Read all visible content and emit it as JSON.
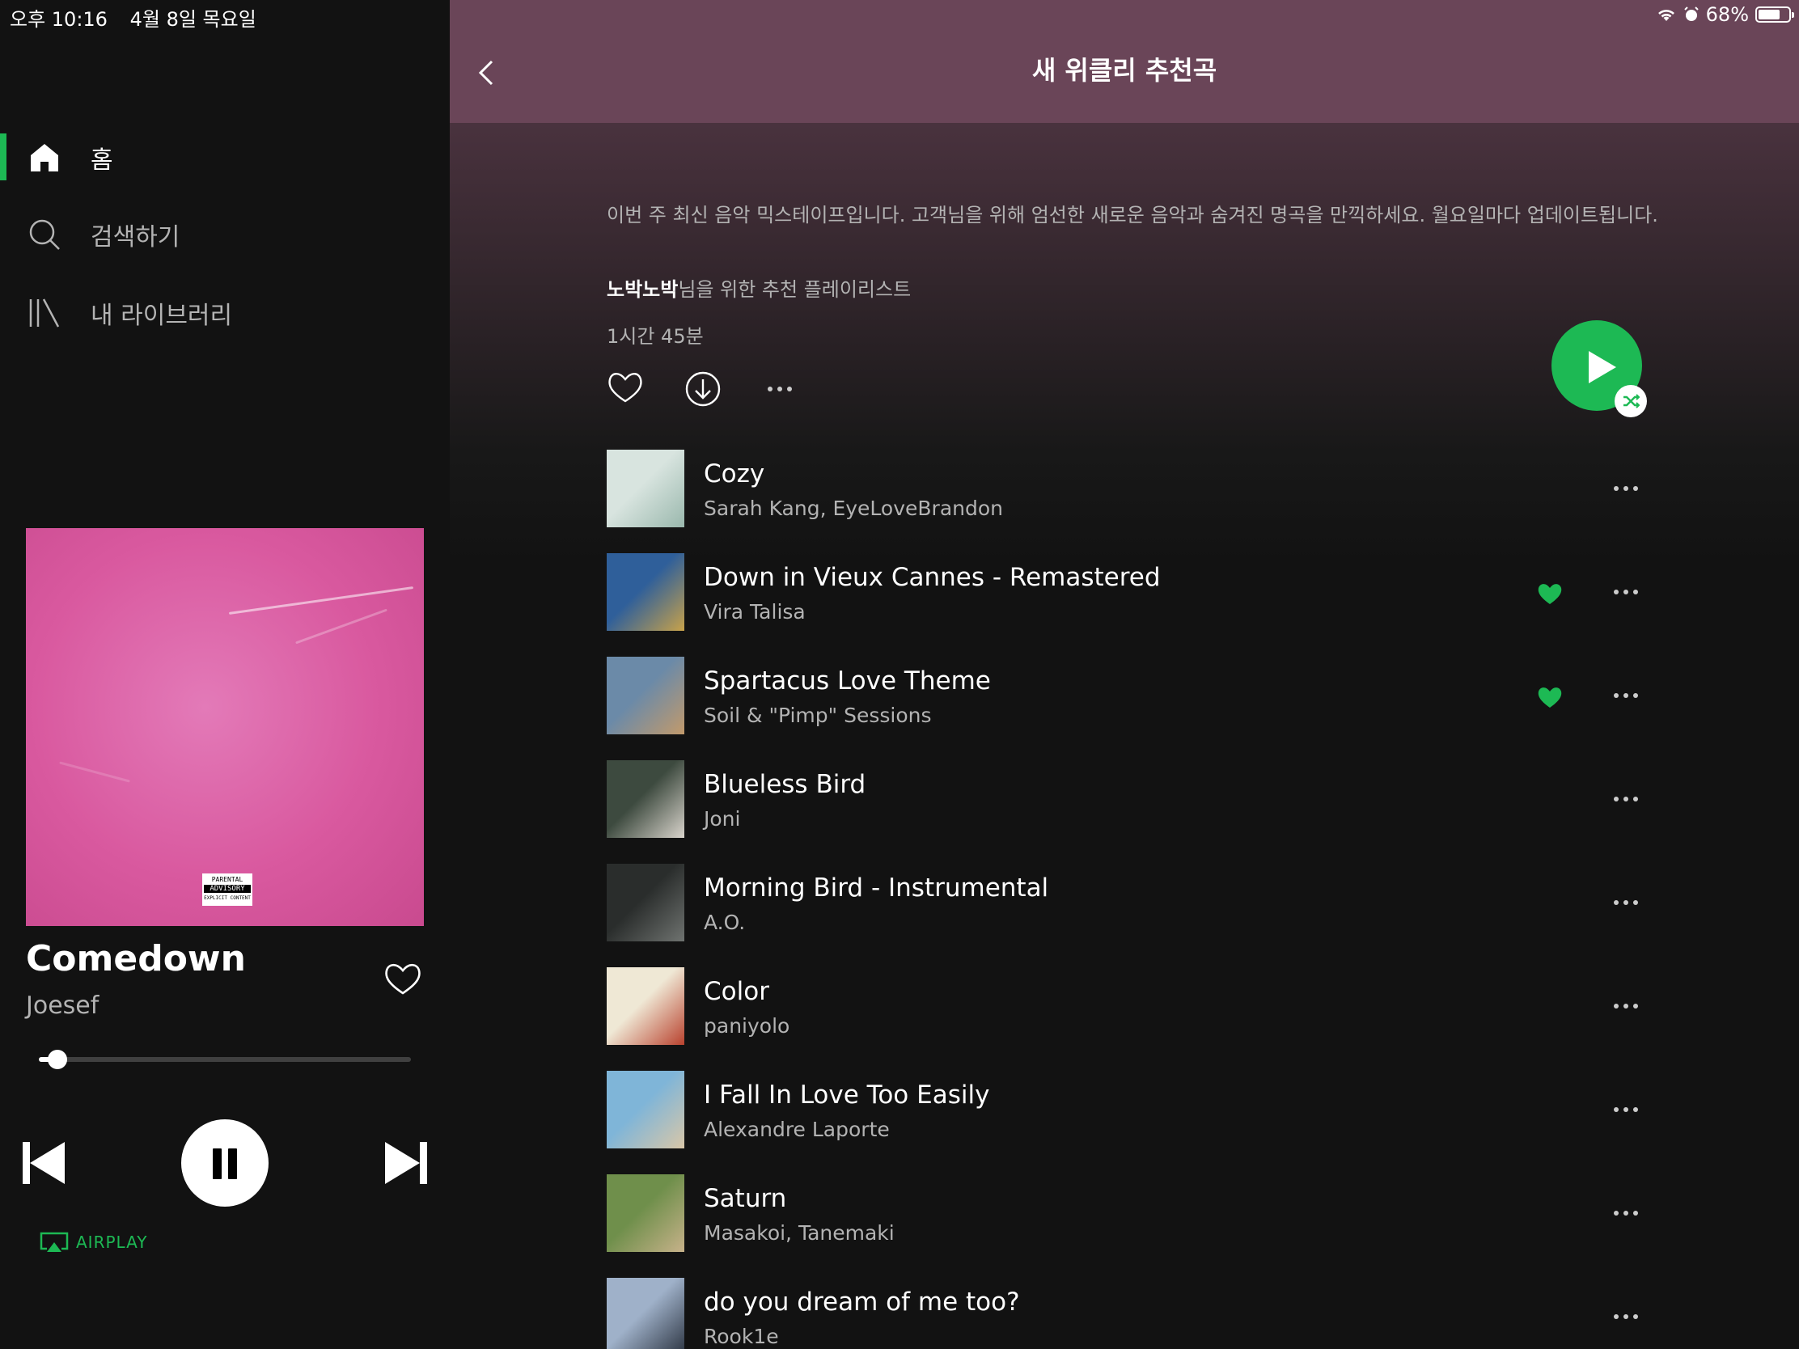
{
  "status_bar": {
    "time": "오후 10:16",
    "date": "4월 8일 목요일",
    "battery": "68%",
    "battery_level": 0.68
  },
  "sidebar": {
    "items": [
      {
        "label": "홈",
        "icon": "home-icon",
        "active": true
      },
      {
        "label": "검색하기",
        "icon": "search-icon",
        "active": false
      },
      {
        "label": "내 라이브러리",
        "icon": "library-icon",
        "active": false
      }
    ]
  },
  "now_playing": {
    "title": "Comedown",
    "artist": "Joesef",
    "progress": 0.05,
    "advisory_line1": "PARENTAL",
    "advisory_line2": "ADVISORY",
    "advisory_line3": "EXPLICIT CONTENT",
    "airplay_label": "AIRPLAY"
  },
  "playlist": {
    "title": "새 위클리 추천곡",
    "description": "이번 주 최신 음악 믹스테이프입니다. 고객님을 위해 엄선한 새로운 음악과 숨겨진 명곡을 만끽하세요. 월요일마다 업데이트됩니다.",
    "made_for_user": "노박노박",
    "made_for_suffix": "님을 위한 추천 플레이리스트",
    "duration": "1시간 45분"
  },
  "tracks": [
    {
      "title": "Cozy",
      "artist": "Sarah Kang, EyeLoveBrandon",
      "liked": false,
      "art": [
        "#d8e4df",
        "#9ab8ad"
      ]
    },
    {
      "title": "Down in Vieux Cannes - Remastered",
      "artist": "Vira Talisa",
      "liked": true,
      "art": [
        "#2f5f9a",
        "#c8a24a"
      ]
    },
    {
      "title": "Spartacus Love Theme",
      "artist": "Soil & \"Pimp\" Sessions",
      "liked": true,
      "art": [
        "#6b8aa8",
        "#c29a6b"
      ]
    },
    {
      "title": "Blueless Bird",
      "artist": "Joni",
      "liked": false,
      "art": [
        "#3d4a3f",
        "#d9d4cc"
      ]
    },
    {
      "title": "Morning Bird - Instrumental",
      "artist": "A.O.",
      "liked": false,
      "art": [
        "#2a2d2c",
        "#6f7370"
      ]
    },
    {
      "title": "Color",
      "artist": "paniyolo",
      "liked": false,
      "art": [
        "#efe8d5",
        "#b9422e"
      ]
    },
    {
      "title": "I Fall In Love Too Easily",
      "artist": "Alexandre Laporte",
      "liked": false,
      "art": [
        "#7fb5d8",
        "#d9c7a8"
      ]
    },
    {
      "title": "Saturn",
      "artist": "Masakoi, Tanemaki",
      "liked": false,
      "art": [
        "#6f8f4b",
        "#c7b28a"
      ]
    },
    {
      "title": "do you dream of me too?",
      "artist": "Rook1e",
      "liked": false,
      "art": [
        "#9fb1c9",
        "#2b3340"
      ]
    }
  ],
  "colors": {
    "accent": "#1db954",
    "header": "#6a4558",
    "background": "#121212"
  }
}
